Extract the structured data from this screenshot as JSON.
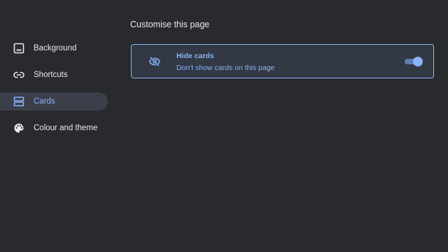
{
  "page": {
    "title": "Customise this page"
  },
  "sidebar": {
    "items": [
      {
        "label": "Background",
        "icon": "background-image-icon",
        "selected": false
      },
      {
        "label": "Shortcuts",
        "icon": "link-icon",
        "selected": false
      },
      {
        "label": "Cards",
        "icon": "cards-icon",
        "selected": true
      },
      {
        "label": "Colour and theme",
        "icon": "palette-icon",
        "selected": false
      }
    ]
  },
  "card": {
    "title": "Hide cards",
    "subtitle": "Don't show cards on this page",
    "icon": "eye-off-icon",
    "toggle_on": true
  },
  "colors": {
    "background": "#292a2d",
    "accent": "#8ab4f8",
    "selected_bg": "#3b3f4a",
    "card_bg": "#323844",
    "text": "#e8eaed"
  }
}
